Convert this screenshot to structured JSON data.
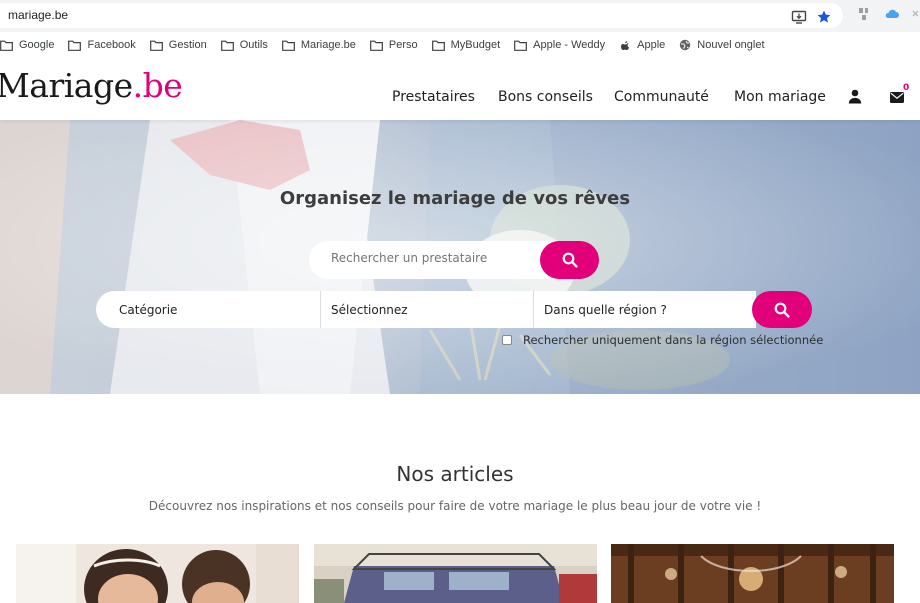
{
  "browser": {
    "url": "mariage.be",
    "bookmarks": [
      {
        "label": "Google",
        "icon": "folder-icon"
      },
      {
        "label": "Facebook",
        "icon": "folder-icon"
      },
      {
        "label": "Gestion",
        "icon": "folder-icon"
      },
      {
        "label": "Outils",
        "icon": "folder-icon"
      },
      {
        "label": "Mariage.be",
        "icon": "folder-icon"
      },
      {
        "label": "Perso",
        "icon": "folder-icon"
      },
      {
        "label": "MyBudget",
        "icon": "folder-icon"
      },
      {
        "label": "Apple - Weddy",
        "icon": "folder-icon"
      },
      {
        "label": "Apple",
        "icon": "apple-icon"
      },
      {
        "label": "Nouvel onglet",
        "icon": "globe-icon"
      }
    ]
  },
  "header": {
    "logo_main": "Mariage",
    "logo_tld": ".be",
    "nav": [
      "Prestataires",
      "Bons conseils",
      "Communauté",
      "Mon mariage"
    ],
    "cart_count": "0",
    "brand_color": "#e2007a"
  },
  "hero": {
    "title": "Organisez le mariage de vos rêves",
    "search_placeholder": "Rechercher un prestataire",
    "filter_category": "Catégorie",
    "filter_select": "Sélectionnez",
    "filter_region": "Dans quelle région ?",
    "region_only_label": "Rechercher uniquement dans la région sélectionnée"
  },
  "articles": {
    "title": "Nos articles",
    "subtitle": "Découvrez nos inspirations et nos conseils pour faire de votre mariage le plus beau jour de votre vie !"
  }
}
